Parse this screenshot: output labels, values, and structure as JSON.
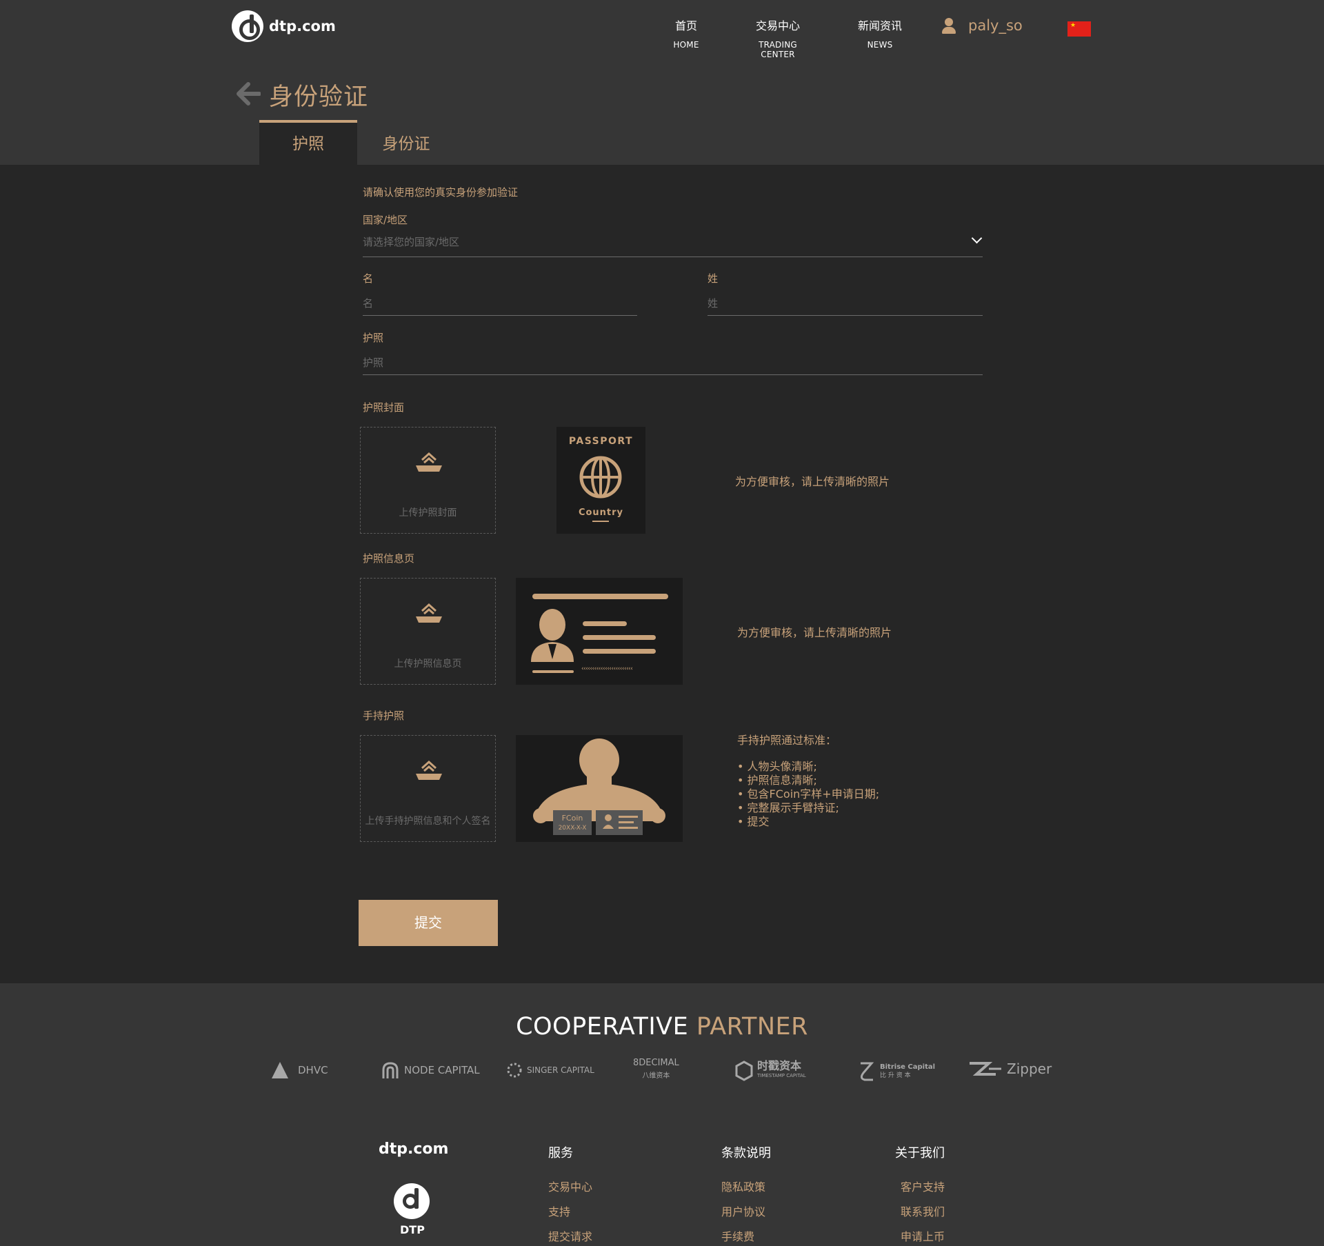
{
  "header": {
    "logo_text": "dtp.com",
    "nav": [
      {
        "zh": "首页",
        "en": "HOME"
      },
      {
        "zh": "交易中心",
        "en": "TRADING CENTER"
      },
      {
        "zh": "新闻资讯",
        "en": "NEWS"
      }
    ],
    "username": "paly_so",
    "language_flag": "cn-flag"
  },
  "page": {
    "title": "身份验证",
    "tabs": [
      "护照",
      "身份证"
    ],
    "active_tab": "护照"
  },
  "form": {
    "intro": "请确认使用您的真实身份参加验证",
    "country_label": "国家/地区",
    "country_placeholder": "请选择您的国家/地区",
    "first_name_label": "名",
    "first_name_placeholder": "名",
    "last_name_label": "姓",
    "last_name_placeholder": "姓",
    "passport_label": "护照",
    "passport_placeholder": "护照",
    "cover_section": "护照封面",
    "cover_upload": "上传护照封面",
    "cover_sample_title": "PASSPORT",
    "cover_sample_country": "Country",
    "cover_hint": "为方便审核，请上传清晰的照片",
    "info_section": "护照信息页",
    "info_upload": "上传护照信息页",
    "info_sample_mrz": "‹‹‹‹‹‹‹‹‹‹‹‹‹‹‹‹‹‹‹‹‹‹‹‹",
    "info_hint": "为方便审核，请上传清晰的照片",
    "hold_section": "手持护照",
    "hold_upload": "上传手持护照信息和个人签名",
    "hold_sample_brand": "FCoin",
    "hold_sample_date": "20XX-X-X",
    "hold_hint_title": "手持护照通过标准：",
    "hold_hint_items": [
      "人物头像清晰;",
      "护照信息清晰;",
      "包含FCoin字样+申请日期;",
      "完整展示手臂持证;",
      "提交"
    ],
    "submit": "提交"
  },
  "footer": {
    "coop_white": "COOPERATIVE",
    "coop_gold": "PARTNER",
    "partners": [
      {
        "name": "DHVC",
        "icon": "dhvc-logo"
      },
      {
        "name": "NODE CAPITAL",
        "icon": "node-capital-logo"
      },
      {
        "name": "SINGER CAPITAL",
        "icon": "singer-capital-logo"
      },
      {
        "name": "8DECIMAL",
        "sub": "八维资本",
        "icon": "8decimal-logo"
      },
      {
        "name": "时戳资本",
        "sub": "TIMESTAMP CAPITAL",
        "icon": "timestamp-capital-logo"
      },
      {
        "name": "Bitrise Capital",
        "sub": "比 升 资 本",
        "icon": "bitrise-capital-logo"
      },
      {
        "name": "Zipper",
        "icon": "zipper-logo"
      }
    ],
    "brand": "dtp.com",
    "logo_label": "DTP",
    "columns": [
      {
        "title": "服务",
        "links": [
          "交易中心",
          "支持",
          "提交请求"
        ]
      },
      {
        "title": "条款说明",
        "links": [
          "隐私政策",
          "用户协议",
          "手续费"
        ]
      },
      {
        "title": "关于我们",
        "links": [
          "客户支持",
          "联系我们",
          "申请上币"
        ]
      }
    ]
  },
  "colors": {
    "accent": "#c8a27a",
    "header_bg": "#363636",
    "page_bg": "#262626",
    "sample_bg": "#1b1b1b"
  }
}
